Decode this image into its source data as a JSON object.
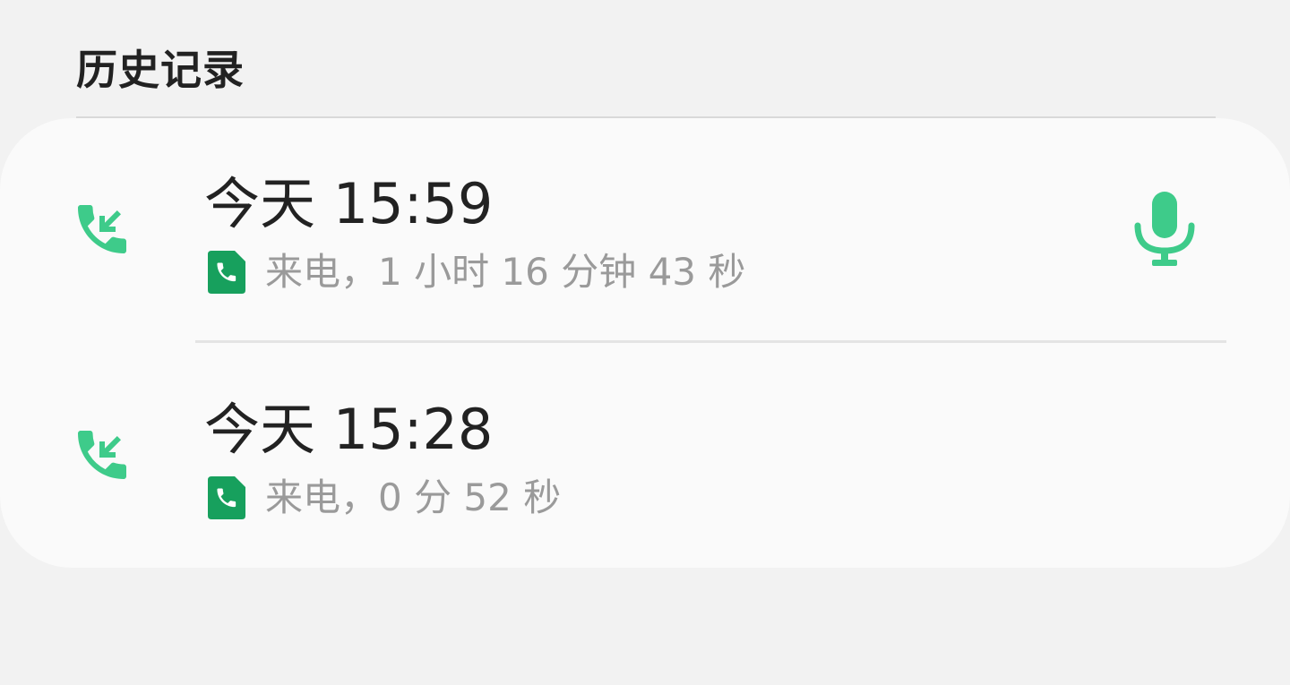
{
  "header": {
    "title": "历史记录"
  },
  "colors": {
    "accent_green": "#3ecb8a",
    "sim_green": "#17a05d",
    "text_primary": "#222222",
    "text_secondary": "#9a9a9a"
  },
  "calls": [
    {
      "type_icon": "incoming-call-icon",
      "time": "今天 15:59",
      "sim_icon": "sim-phone-icon",
      "detail": "来电，1 小时 16 分钟 43 秒",
      "has_recording": true,
      "recording_icon": "microphone-icon"
    },
    {
      "type_icon": "incoming-call-icon",
      "time": "今天 15:28",
      "sim_icon": "sim-phone-icon",
      "detail": "来电，0 分 52 秒",
      "has_recording": false
    }
  ]
}
